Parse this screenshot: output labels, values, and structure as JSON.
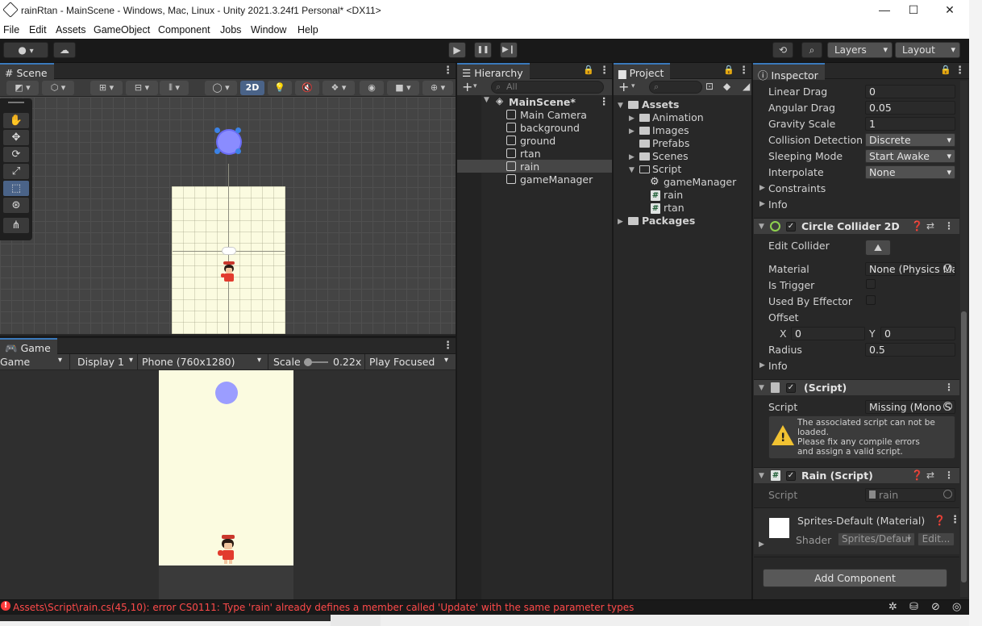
{
  "window": {
    "title": "rainRtan - MainScene - Windows, Mac, Linux - Unity 2021.3.24f1 Personal* <DX11>",
    "minimize": "—",
    "maximize": "☐",
    "close": "✕"
  },
  "menu": [
    "File",
    "Edit",
    "Assets",
    "GameObject",
    "Component",
    "Jobs",
    "Window",
    "Help"
  ],
  "toolbar": {
    "account_icon": "account-icon",
    "cloud_icon": "cloud-icon",
    "play": "▶",
    "pause": "❚❚",
    "step": "▶❙",
    "layers_label": "Layers",
    "layout_label": "Layout"
  },
  "scene": {
    "tab": "Scene",
    "mode_2d": "2D"
  },
  "game": {
    "tab": "Game",
    "view_select": "Game",
    "display": "Display 1",
    "resolution": "Phone (760x1280)",
    "scale_label": "Scale",
    "scale_value": "0.22x",
    "play_mode": "Play Focused"
  },
  "hierarchy": {
    "tab": "Hierarchy",
    "search_placeholder": "All",
    "scene_name": "MainScene*",
    "items": [
      "Main Camera",
      "background",
      "ground",
      "rtan",
      "rain",
      "gameManager"
    ],
    "selected": "rain"
  },
  "project": {
    "tab": "Project",
    "assets": "Assets",
    "folders": [
      "Animation",
      "Images",
      "Prefabs",
      "Scenes",
      "Script"
    ],
    "script_children": [
      "gameManager",
      "rain",
      "rtan"
    ],
    "packages": "Packages"
  },
  "inspector": {
    "tab": "Inspector",
    "rigidbody": {
      "linear_drag_label": "Linear Drag",
      "linear_drag": "0",
      "angular_drag_label": "Angular Drag",
      "angular_drag": "0.05",
      "gravity_scale_label": "Gravity Scale",
      "gravity_scale": "1",
      "collision_label": "Collision Detection",
      "collision": "Discrete",
      "sleeping_label": "Sleeping Mode",
      "sleeping": "Start Awake",
      "interpolate_label": "Interpolate",
      "interpolate": "None",
      "constraints": "Constraints",
      "info": "Info"
    },
    "circle_collider": {
      "title": "Circle Collider 2D",
      "edit_collider": "Edit Collider",
      "material_label": "Material",
      "material": "None (Physics Mat",
      "is_trigger": "Is Trigger",
      "used_by_effector": "Used By Effector",
      "offset_label": "Offset",
      "x_label": "X",
      "x": "0",
      "y_label": "Y",
      "y": "0",
      "radius_label": "Radius",
      "radius": "0.5",
      "info": "Info"
    },
    "missing_script": {
      "title": "(Script)",
      "script_label": "Script",
      "script": "Missing (Mono S",
      "warning_line1": "The associated script can not be",
      "warning_line2": "loaded.",
      "warning_line3": "Please fix any compile errors",
      "warning_line4": "and assign a valid script."
    },
    "rain_script": {
      "title": "Rain (Script)",
      "script_label": "Script",
      "script": "rain"
    },
    "material": {
      "title": "Sprites-Default (Material)",
      "shader_label": "Shader",
      "shader": "Sprites/Defaul",
      "edit": "Edit..."
    },
    "add_component": "Add Component"
  },
  "status": {
    "error": "Assets\\Script\\rain.cs(45,10): error CS0111: Type 'rain' already defines a member called 'Update' with the same parameter types"
  },
  "colors": {
    "accent": "#3a79bb",
    "error": "#ff4a4a",
    "scene_bg": "#fbfbe0",
    "rain_drop": "#9b9dff"
  }
}
